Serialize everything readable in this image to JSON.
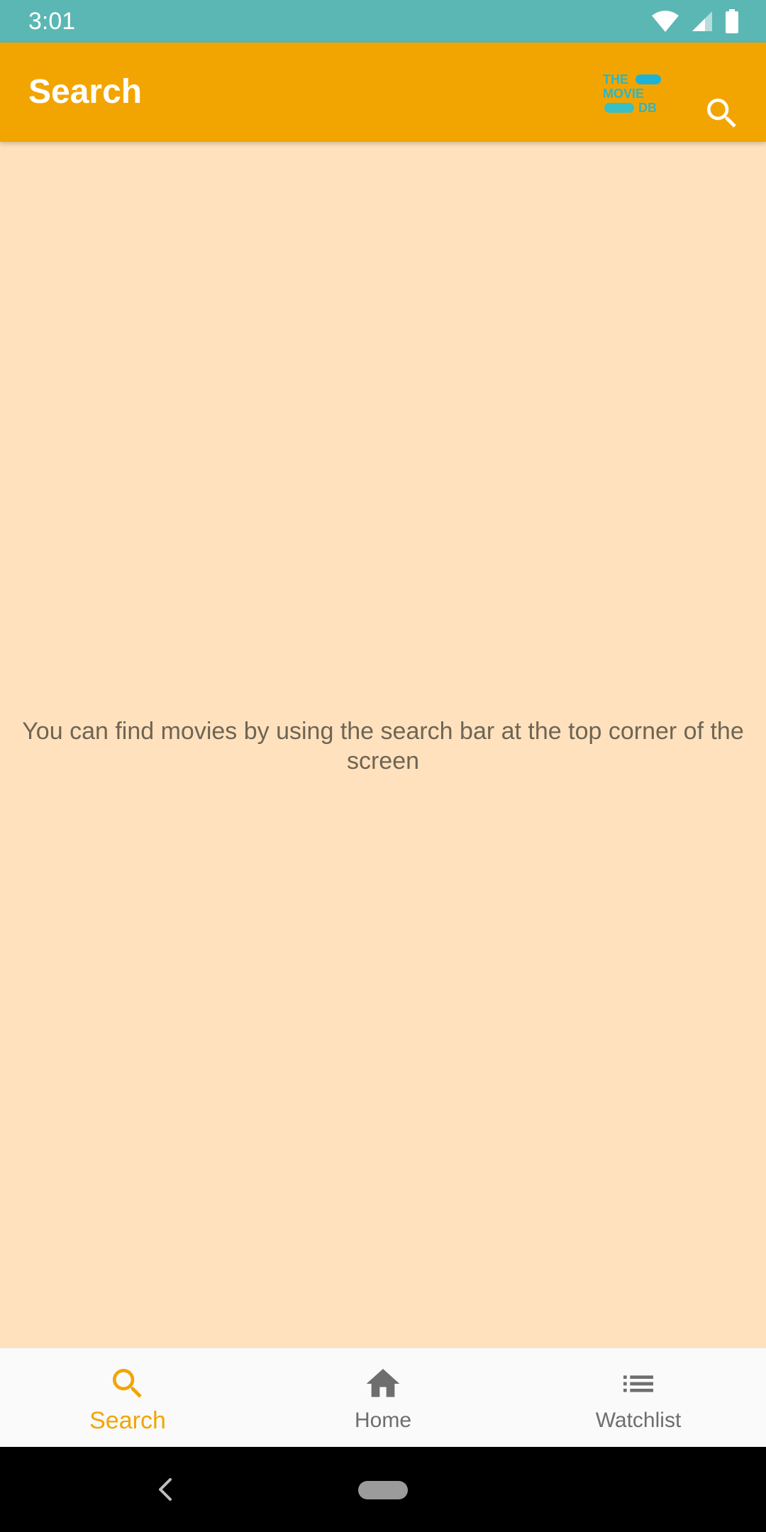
{
  "status_bar": {
    "time": "3:01",
    "icons": [
      "wifi-icon",
      "signal-icon",
      "battery-icon"
    ],
    "background": "#5BB7B3"
  },
  "app_bar": {
    "title": "Search",
    "logo": "tmdb-logo",
    "logo_text": [
      "THE",
      "MOVIE",
      "DB"
    ],
    "action_icon": "search-icon",
    "background": "#F2A500"
  },
  "main": {
    "empty_message": "You can find movies by using the search bar at the top corner of the screen",
    "background": "#FFE2BD"
  },
  "bottom_nav": {
    "items": [
      {
        "label": "Search",
        "icon": "search-icon",
        "active": true
      },
      {
        "label": "Home",
        "icon": "home-icon",
        "active": false
      },
      {
        "label": "Watchlist",
        "icon": "list-icon",
        "active": false
      }
    ],
    "active_color": "#F2A500",
    "inactive_color": "#6E6E6E"
  },
  "system_nav": {
    "back_icon": "back-chevron-icon",
    "home_icon": "home-pill"
  }
}
